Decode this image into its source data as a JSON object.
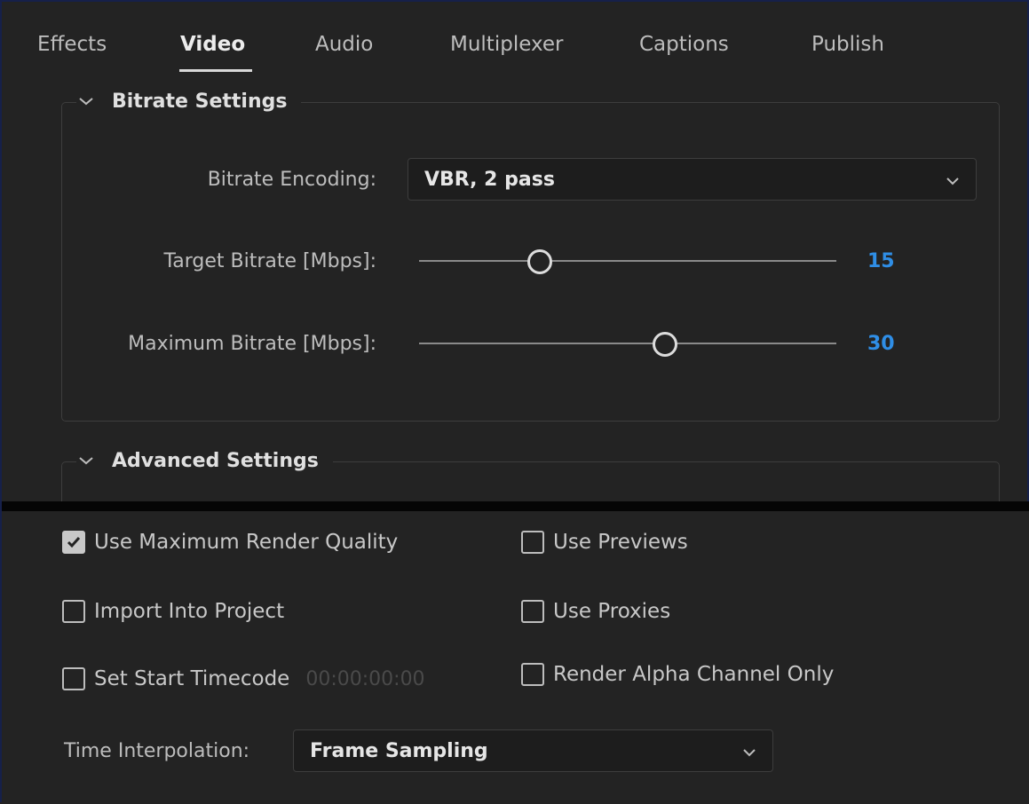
{
  "tabs": [
    {
      "label": "Effects"
    },
    {
      "label": "Video"
    },
    {
      "label": "Audio"
    },
    {
      "label": "Multiplexer"
    },
    {
      "label": "Captions"
    },
    {
      "label": "Publish"
    }
  ],
  "active_tab": "Video",
  "bitrate_section": {
    "title": "Bitrate Settings",
    "encoding_label": "Bitrate Encoding:",
    "encoding_value": "VBR, 2 pass",
    "target_label": "Target Bitrate [Mbps]:",
    "target_value": "15",
    "target_level": 0.29,
    "max_label": "Maximum Bitrate [Mbps]:",
    "max_value": "30",
    "max_level": 0.59
  },
  "advanced_section": {
    "title": "Advanced Settings"
  },
  "options": {
    "use_max_render_quality": {
      "label": "Use Maximum Render Quality",
      "checked": true
    },
    "use_previews": {
      "label": "Use Previews",
      "checked": false
    },
    "import_into_project": {
      "label": "Import Into Project",
      "checked": false
    },
    "use_proxies": {
      "label": "Use Proxies",
      "checked": false
    },
    "set_start_timecode": {
      "label": "Set Start Timecode",
      "checked": false,
      "timecode": "00:00:00:00"
    },
    "render_alpha_only": {
      "label": "Render Alpha Channel Only",
      "checked": false
    }
  },
  "time_interpolation": {
    "label": "Time Interpolation:",
    "value": "Frame Sampling"
  },
  "colors": {
    "background": "#232323",
    "accent_value": "#2f8ee6",
    "text": "#c8c8c8"
  },
  "icons": [
    "chevron-down-icon",
    "dropdown-caret-icon",
    "checkmark-icon"
  ]
}
